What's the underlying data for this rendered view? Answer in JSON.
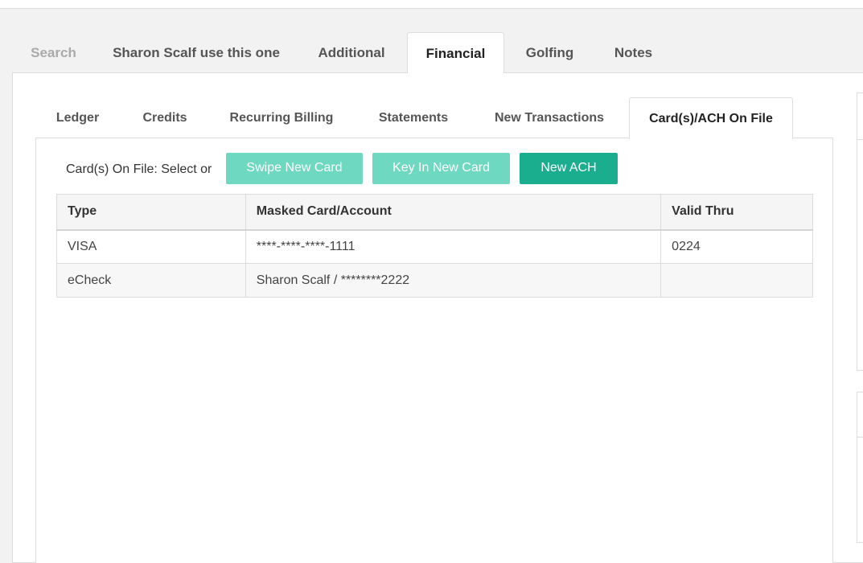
{
  "top_tabs": [
    {
      "label": "Search",
      "state": "muted"
    },
    {
      "label": "Sharon Scalf use this one",
      "state": "normal"
    },
    {
      "label": "Additional",
      "state": "normal"
    },
    {
      "label": "Financial",
      "state": "active"
    },
    {
      "label": "Golfing",
      "state": "normal"
    },
    {
      "label": "Notes",
      "state": "normal"
    }
  ],
  "sub_tabs": [
    {
      "label": "Ledger"
    },
    {
      "label": "Credits"
    },
    {
      "label": "Recurring Billing"
    },
    {
      "label": "Statements"
    },
    {
      "label": "New Transactions"
    },
    {
      "label": "Card(s)/ACH On File",
      "state": "active"
    }
  ],
  "card_toolbar": {
    "label": "Card(s) On File: Select or",
    "swipe_button": "Swipe New Card",
    "key_in_button": "Key In New Card",
    "new_ach_button": "New ACH"
  },
  "cards_table": {
    "columns": [
      "Type",
      "Masked Card/Account",
      "Valid Thru"
    ],
    "rows": [
      [
        "VISA",
        "****-****-****-1111",
        "0224"
      ],
      [
        "eCheck",
        "Sharon Scalf / ********2222",
        ""
      ]
    ]
  },
  "colors": {
    "accent_light": "#6ed8c1",
    "accent_dark": "#1aae8f"
  }
}
